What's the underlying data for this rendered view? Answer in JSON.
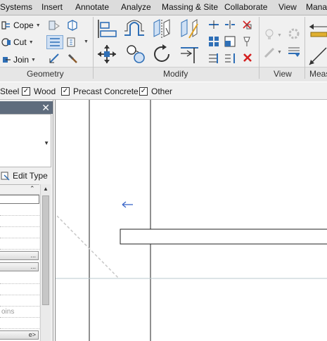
{
  "menu": {
    "items": [
      "Systems",
      "Insert",
      "Annotate",
      "Analyze",
      "Massing & Site",
      "Collaborate",
      "View",
      "Manag"
    ]
  },
  "ribbon": {
    "geometry": {
      "label": "Geometry",
      "cope_label": "Cope",
      "cut_label": "Cut",
      "join_label": "Join"
    },
    "modify": {
      "label": "Modify"
    },
    "view": {
      "label": "View"
    },
    "measure": {
      "label": "Meas"
    }
  },
  "filters": {
    "items": [
      {
        "label": "Steel",
        "checked": true
      },
      {
        "label": "Wood",
        "checked": true
      },
      {
        "label": "Precast Concrete",
        "checked": true
      },
      {
        "label": "Other",
        "checked": true
      }
    ]
  },
  "properties": {
    "edit_type_label": "Edit Type",
    "faint_row_text": "oins",
    "button_text": "e>"
  },
  "colors": {
    "menubar_bg": "#dcdcdc",
    "ribbon_bg": "#f0f0f0",
    "palette_header": "#5f6c7d",
    "icon_blue": "#2f6fb6",
    "delete_red": "#d42020",
    "annotation_blue": "#3a66c8",
    "reference_line": "#b8c8cc"
  }
}
